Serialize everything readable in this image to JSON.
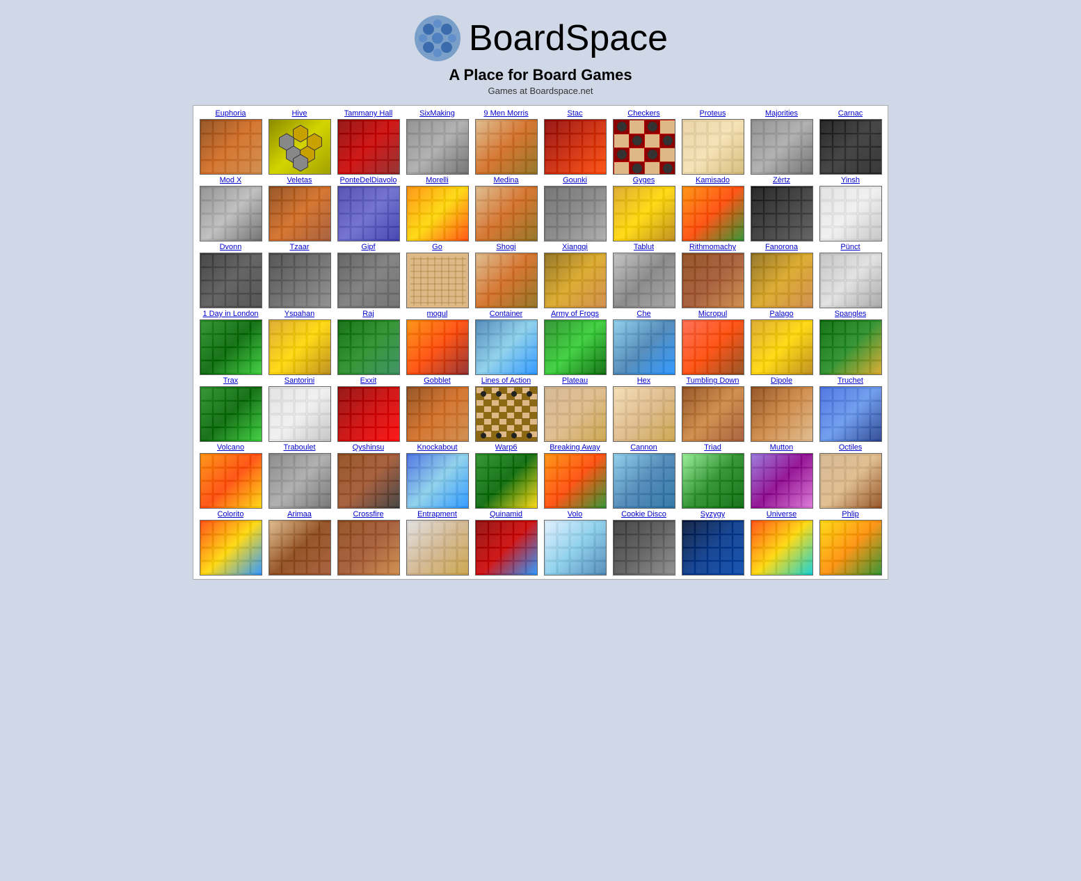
{
  "site": {
    "title": "BoardSpace",
    "tagline": "A Place for Board Games",
    "subtitle": "Games at Boardspace.net"
  },
  "games": [
    {
      "id": "euphoria",
      "name": "Euphoria",
      "thumb_class": "thumb-euphoria"
    },
    {
      "id": "hive",
      "name": "Hive",
      "thumb_class": "thumb-hive"
    },
    {
      "id": "tammany",
      "name": "Tammany Hall",
      "thumb_class": "thumb-tammany"
    },
    {
      "id": "sixmaking",
      "name": "SixMaking",
      "thumb_class": "thumb-sixmaking"
    },
    {
      "id": "9menmorris",
      "name": "9 Men Morris",
      "thumb_class": "thumb-9men"
    },
    {
      "id": "stac",
      "name": "Stac",
      "thumb_class": "thumb-stac"
    },
    {
      "id": "checkers",
      "name": "Checkers",
      "thumb_class": "thumb-checkers"
    },
    {
      "id": "proteus",
      "name": "Proteus",
      "thumb_class": "thumb-proteus"
    },
    {
      "id": "majorities",
      "name": "Majorities",
      "thumb_class": "thumb-majorities"
    },
    {
      "id": "carnac",
      "name": "Carnac",
      "thumb_class": "thumb-carnac"
    },
    {
      "id": "modx",
      "name": "Mod X",
      "thumb_class": "thumb-modx"
    },
    {
      "id": "veletas",
      "name": "Veletas",
      "thumb_class": "thumb-veletas"
    },
    {
      "id": "pontedeldiavolo",
      "name": "PonteDelDiavolo",
      "thumb_class": "thumb-ponte"
    },
    {
      "id": "morelli",
      "name": "Morelli",
      "thumb_class": "thumb-morelli"
    },
    {
      "id": "medina",
      "name": "Medina",
      "thumb_class": "thumb-medina"
    },
    {
      "id": "gounki",
      "name": "Gounki",
      "thumb_class": "thumb-gounki"
    },
    {
      "id": "gyges",
      "name": "Gyges",
      "thumb_class": "thumb-gyges"
    },
    {
      "id": "kamisado",
      "name": "Kamisado",
      "thumb_class": "thumb-kamisado"
    },
    {
      "id": "zertz",
      "name": "Zèrtz",
      "thumb_class": "thumb-zertz"
    },
    {
      "id": "yinsh",
      "name": "Yinsh",
      "thumb_class": "thumb-yinsh"
    },
    {
      "id": "dvonn",
      "name": "Dvonn",
      "thumb_class": "thumb-dvonn"
    },
    {
      "id": "tzaar",
      "name": "Tzaar",
      "thumb_class": "thumb-tzaar"
    },
    {
      "id": "gipf",
      "name": "Gipf",
      "thumb_class": "thumb-gipf"
    },
    {
      "id": "go",
      "name": "Go",
      "thumb_class": "thumb-go"
    },
    {
      "id": "shogi",
      "name": "Shogi",
      "thumb_class": "thumb-shogi"
    },
    {
      "id": "xiangqi",
      "name": "Xiangqi",
      "thumb_class": "thumb-xiangqi"
    },
    {
      "id": "tablut",
      "name": "Tablut",
      "thumb_class": "thumb-tablut"
    },
    {
      "id": "rithmomachy",
      "name": "Rithmomachy",
      "thumb_class": "thumb-rithmo"
    },
    {
      "id": "fanorona",
      "name": "Fanorona",
      "thumb_class": "thumb-fanorona"
    },
    {
      "id": "punct",
      "name": "Pünct",
      "thumb_class": "thumb-punct"
    },
    {
      "id": "1dayinlondon",
      "name": "1 Day in London",
      "thumb_class": "thumb-1day"
    },
    {
      "id": "yspahan",
      "name": "Yspahan",
      "thumb_class": "thumb-yspahan"
    },
    {
      "id": "raj",
      "name": "Raj",
      "thumb_class": "thumb-raj"
    },
    {
      "id": "mogul",
      "name": "mogul",
      "thumb_class": "thumb-mogul"
    },
    {
      "id": "container",
      "name": "Container",
      "thumb_class": "thumb-container"
    },
    {
      "id": "armyoffrogs",
      "name": "Army of Frogs",
      "thumb_class": "thumb-armyfrogs"
    },
    {
      "id": "che",
      "name": "Che",
      "thumb_class": "thumb-che"
    },
    {
      "id": "micropul",
      "name": "Micropul",
      "thumb_class": "thumb-micropul"
    },
    {
      "id": "palago",
      "name": "Palago",
      "thumb_class": "thumb-palago"
    },
    {
      "id": "spangles",
      "name": "Spangles",
      "thumb_class": "thumb-spangles"
    },
    {
      "id": "trax",
      "name": "Trax",
      "thumb_class": "thumb-trax"
    },
    {
      "id": "santorini",
      "name": "Santorini",
      "thumb_class": "thumb-santorini"
    },
    {
      "id": "exxit",
      "name": "Exxit",
      "thumb_class": "thumb-exxit"
    },
    {
      "id": "gobblet",
      "name": "Gobblet",
      "thumb_class": "thumb-gobblet"
    },
    {
      "id": "linesofaction",
      "name": "Lines of Action",
      "thumb_class": "thumb-loa"
    },
    {
      "id": "plateau",
      "name": "Plateau",
      "thumb_class": "thumb-plateau"
    },
    {
      "id": "hex",
      "name": "Hex",
      "thumb_class": "thumb-hex"
    },
    {
      "id": "tumblingdown",
      "name": "Tumbling Down",
      "thumb_class": "thumb-tumbling"
    },
    {
      "id": "dipole",
      "name": "Dipole",
      "thumb_class": "thumb-dipole"
    },
    {
      "id": "truchet",
      "name": "Truchet",
      "thumb_class": "thumb-truchet"
    },
    {
      "id": "volcano",
      "name": "Volcano",
      "thumb_class": "thumb-volcano"
    },
    {
      "id": "traboulet",
      "name": "Traboulet",
      "thumb_class": "thumb-traboulet"
    },
    {
      "id": "qyshinsu",
      "name": "Qyshinsu",
      "thumb_class": "thumb-qyshinsu"
    },
    {
      "id": "knockabout",
      "name": "Knockabout",
      "thumb_class": "thumb-knockabout"
    },
    {
      "id": "warp6",
      "name": "Warp6",
      "thumb_class": "thumb-warp6"
    },
    {
      "id": "breakingaway",
      "name": "Breaking Away",
      "thumb_class": "thumb-breaking"
    },
    {
      "id": "cannon",
      "name": "Cannon",
      "thumb_class": "thumb-cannon"
    },
    {
      "id": "triad",
      "name": "Triad",
      "thumb_class": "thumb-triad"
    },
    {
      "id": "mutton",
      "name": "Mutton",
      "thumb_class": "thumb-mutton"
    },
    {
      "id": "octiles",
      "name": "Octiles",
      "thumb_class": "thumb-octiles"
    },
    {
      "id": "colorito",
      "name": "Colorito",
      "thumb_class": "thumb-colorito"
    },
    {
      "id": "arimaa",
      "name": "Arimaa",
      "thumb_class": "thumb-arimaa"
    },
    {
      "id": "crossfire",
      "name": "Crossfire",
      "thumb_class": "thumb-crossfire"
    },
    {
      "id": "entrapment",
      "name": "Entrapment",
      "thumb_class": "thumb-entrapment"
    },
    {
      "id": "quinamid",
      "name": "Quinamid",
      "thumb_class": "thumb-quinamid"
    },
    {
      "id": "volo",
      "name": "Volo",
      "thumb_class": "thumb-volo"
    },
    {
      "id": "cookiedisco",
      "name": "Cookie Disco",
      "thumb_class": "thumb-cookie"
    },
    {
      "id": "syzygy",
      "name": "Syzygy",
      "thumb_class": "thumb-syzygy"
    },
    {
      "id": "universe",
      "name": "Universe",
      "thumb_class": "thumb-universe"
    },
    {
      "id": "phlip",
      "name": "Phlip",
      "thumb_class": "thumb-phlip"
    }
  ]
}
